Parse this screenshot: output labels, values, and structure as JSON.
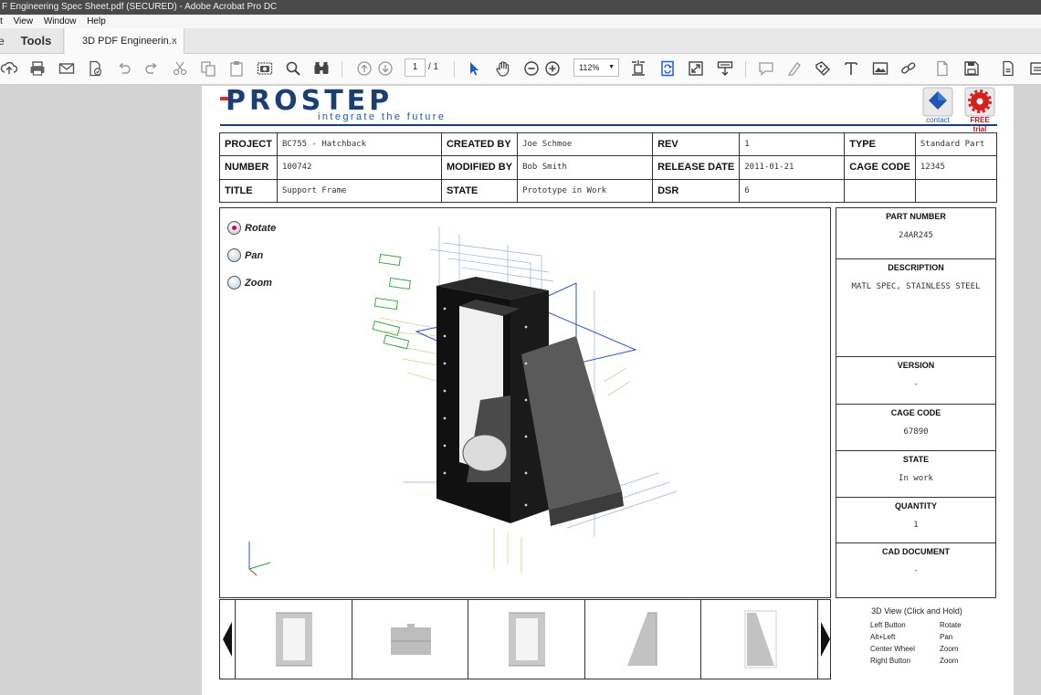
{
  "window": {
    "title": "F Engineering Spec Sheet.pdf (SECURED) - Adobe Acrobat Pro DC"
  },
  "menu": {
    "items": [
      "t",
      "View",
      "Window",
      "Help"
    ]
  },
  "tabs": {
    "home": "e",
    "tools": "Tools",
    "document": "3D PDF Engineerin...",
    "close": "×"
  },
  "toolbar": {
    "page_current": "1",
    "page_total": "/ 1",
    "zoom": "112%",
    "icons": [
      "upload-icon",
      "print-icon",
      "email-icon",
      "save-document-icon",
      "undo-icon",
      "redo-icon",
      "cut-icon",
      "copy-icon",
      "paste-icon",
      "snapshot-icon",
      "search-icon",
      "find-icon",
      "prev-page-icon",
      "next-page-icon",
      "select-cursor-icon",
      "hand-icon",
      "zoom-out-icon",
      "zoom-in-icon",
      "fit-width-icon",
      "rotate-icon",
      "full-screen-icon",
      "scroll-icon",
      "comment-icon",
      "highlight-icon",
      "stamp-icon",
      "text-icon",
      "image-icon",
      "link-icon",
      "attach-icon",
      "save-icon",
      "export-icon",
      "more-icon"
    ]
  },
  "document": {
    "logo": {
      "name": "PROSTEP",
      "tagline": "integrate the future"
    },
    "buttons": {
      "contact": "contact",
      "trial": "FREE trial"
    },
    "header_rows": [
      [
        {
          "k": "PROJECT",
          "v": "BC755 - Hatchback"
        },
        {
          "k": "CREATED BY",
          "v": "Joe Schmoe"
        },
        {
          "k": "REV",
          "v": "1"
        },
        {
          "k": "TYPE",
          "v": "Standard Part"
        }
      ],
      [
        {
          "k": "NUMBER",
          "v": "100742"
        },
        {
          "k": "MODIFIED BY",
          "v": "Bob Smith"
        },
        {
          "k": "RELEASE DATE",
          "v": "2011-01-21"
        },
        {
          "k": "CAGE CODE",
          "v": "12345"
        }
      ],
      [
        {
          "k": "TITLE",
          "v": "Support Frame"
        },
        {
          "k": "STATE",
          "v": "Prototype in Work"
        },
        {
          "k": "DSR",
          "v": "6"
        },
        {
          "k": "",
          "v": ""
        }
      ]
    ],
    "modes": [
      "Rotate",
      "Pan",
      "Zoom"
    ],
    "selected_mode": "Rotate",
    "properties": [
      {
        "title": "PART NUMBER",
        "value": "24AR245"
      },
      {
        "title": "DESCRIPTION",
        "value": "MATL SPEC, STAINLESS STEEL"
      },
      {
        "title": "VERSION",
        "value": "-"
      },
      {
        "title": "CAGE CODE",
        "value": "67890"
      },
      {
        "title": "STATE",
        "value": "In work"
      },
      {
        "title": "QUANTITY",
        "value": "1"
      },
      {
        "title": "CAD DOCUMENT",
        "value": "-"
      }
    ],
    "help": {
      "title": "3D View (Click and Hold)",
      "rows": [
        {
          "action": "Left Button",
          "result": "Rotate"
        },
        {
          "action": "Alt+Left",
          "result": "Pan"
        },
        {
          "action": "Center Wheel",
          "result": "Zoom"
        },
        {
          "action": "Right Button",
          "result": "Zoom"
        }
      ]
    }
  },
  "colors": {
    "brand": "#1b3f73",
    "accent_red": "#d32e2a",
    "titlebar": "#4a4a4a",
    "annotation_green": "#2e9e3a",
    "annotation_blue": "#3050c0"
  }
}
